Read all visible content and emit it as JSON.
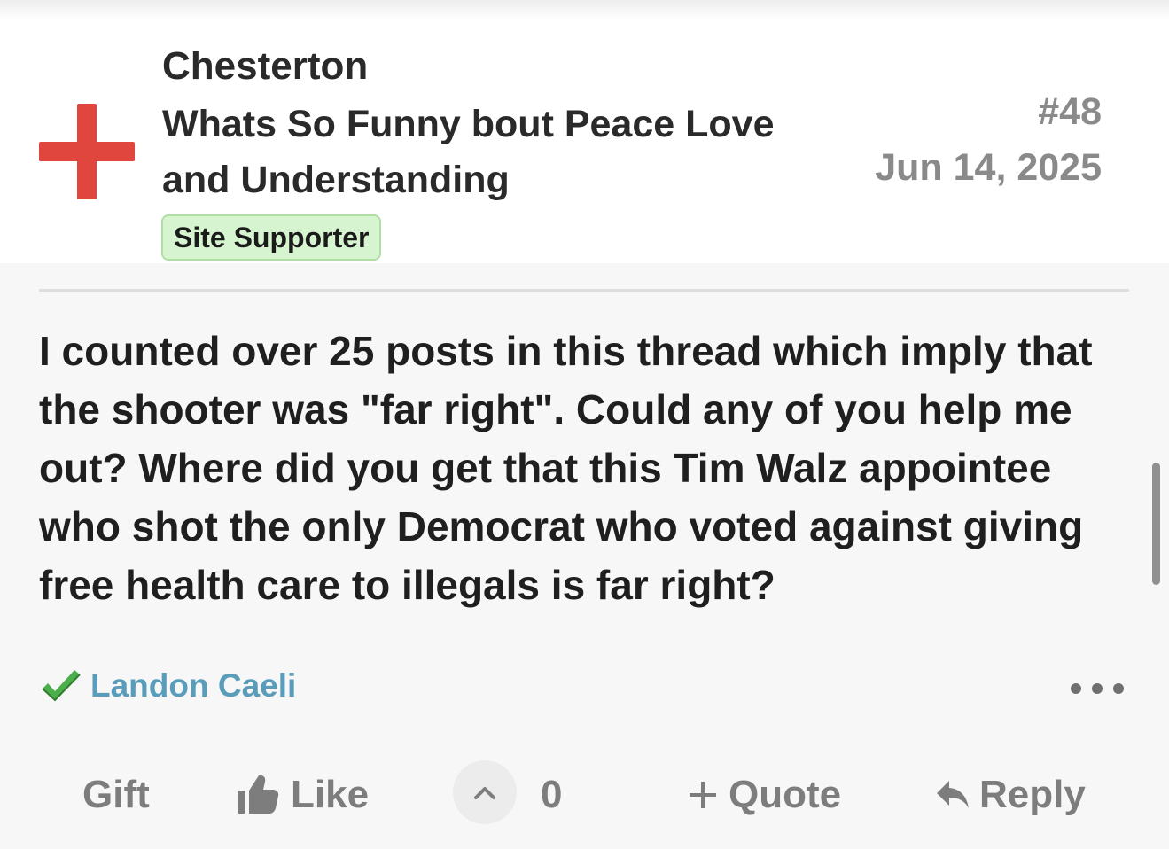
{
  "post": {
    "author": "Chesterton",
    "user_title": "Whats So Funny bout Peace Love and Understanding",
    "badge": "Site Supporter",
    "post_number": "#48",
    "date": "Jun 14, 2025",
    "body": "I counted over 25 posts in this thread which imply that the shooter was \"far right\". Could any of you help me out? Where did you get that this Tim Walz appointee who shot the only Democrat who voted against giving free health care to illegals is far right?",
    "liked_by": "Landon Caeli"
  },
  "actions": {
    "gift": "Gift",
    "like": "Like",
    "vote_count": "0",
    "quote": "Quote",
    "reply": "Reply"
  },
  "colors": {
    "avatar_cross": "#e0463e",
    "badge_bg": "#d6f4cf",
    "link": "#5a9dba",
    "check": "#4cae4c"
  },
  "icons": {
    "avatar": "red-cross",
    "liked": "check-icon",
    "like": "thumbs-up-icon",
    "upvote": "chevron-up-icon",
    "quote": "plus-icon",
    "reply": "reply-arrow-icon",
    "more": "ellipsis-icon"
  }
}
